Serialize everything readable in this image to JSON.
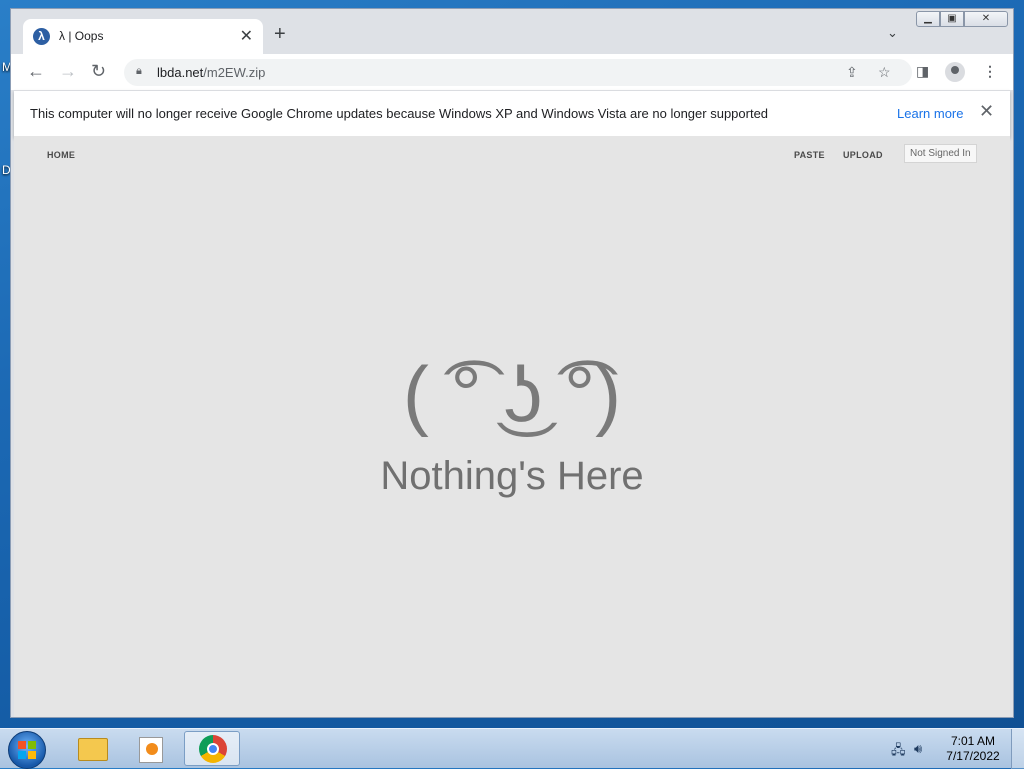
{
  "desktop": {
    "edge_letters": [
      "M",
      "D"
    ]
  },
  "browser": {
    "tab": {
      "title": "λ | Oops",
      "favicon": "lambda-favicon"
    },
    "new_tab": "+",
    "url": {
      "host": "lbda.net",
      "path": "/m2EW.zip"
    },
    "infobar": {
      "message": "This computer will no longer receive Google Chrome updates because Windows XP and Windows Vista are no longer supported",
      "link": "Learn more"
    }
  },
  "page": {
    "nav": {
      "home": "HOME",
      "paste": "PASTE",
      "upload": "UPLOAD",
      "signin": "Not Signed In"
    },
    "face": "( ͡° ͜ʖ ͡°)",
    "message": "Nothing's Here"
  },
  "taskbar": {
    "items": [
      "file-explorer",
      "media-player",
      "chrome"
    ],
    "clock": {
      "time": "7:01 AM",
      "date": "7/17/2022"
    }
  }
}
